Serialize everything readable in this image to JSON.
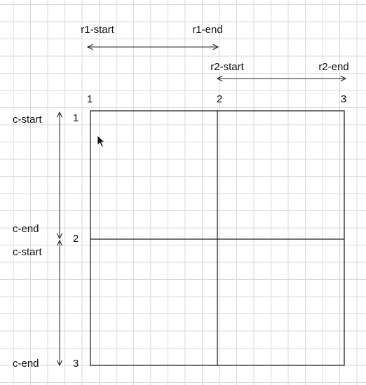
{
  "column_lines": [
    {
      "label": "1"
    },
    {
      "label": "2"
    },
    {
      "label": "3"
    }
  ],
  "row_lines": [
    {
      "label": "1"
    },
    {
      "label": "2"
    },
    {
      "label": "3"
    }
  ],
  "column_spans": [
    {
      "start_label": "r1-start",
      "end_label": "r1-end"
    },
    {
      "start_label": "r2-start",
      "end_label": "r2-end"
    }
  ],
  "row_spans": [
    {
      "start_label": "c-start",
      "end_label": "c-end"
    },
    {
      "start_label": "c-start",
      "end_label": "c-end"
    }
  ],
  "colors": {
    "grid_background_lines": "#d9d9d9",
    "diagram_lines": "#222222",
    "text": "#111111"
  }
}
